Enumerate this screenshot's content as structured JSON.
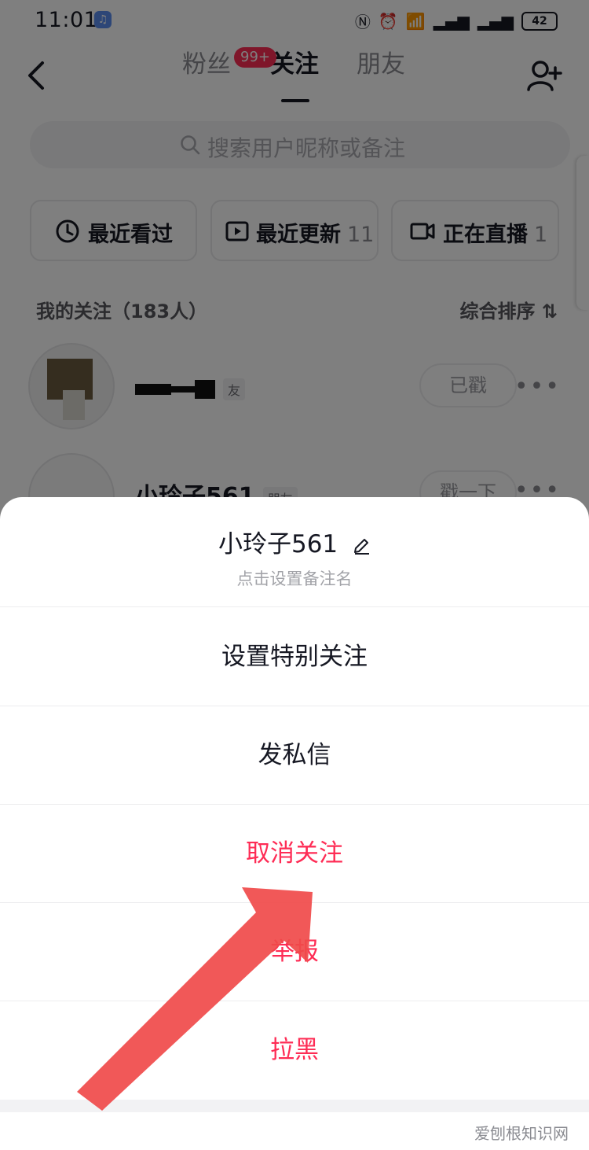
{
  "status_bar": {
    "time": "11:01",
    "battery": "42"
  },
  "header": {
    "tabs": [
      {
        "label": "粉丝"
      },
      {
        "label": "关注"
      },
      {
        "label": "朋友"
      }
    ],
    "fans_badge": "99+"
  },
  "search": {
    "placeholder": "搜索用户昵称或备注"
  },
  "filters": [
    {
      "label": "最近看过",
      "count": ""
    },
    {
      "label": "最近更新",
      "count": "11"
    },
    {
      "label": "正在直播",
      "count": "1"
    }
  ],
  "section": {
    "title": "我的关注（183人）",
    "sort_label": "综合排序"
  },
  "rows": [
    {
      "name": "",
      "tag": "友",
      "action": "已戳"
    },
    {
      "name": "小玲子561",
      "tag": "朋友",
      "action": "戳一下"
    }
  ],
  "sheet": {
    "name": "小玲子561",
    "subtitle": "点击设置备注名",
    "options": [
      {
        "label": "设置特别关注",
        "color": "#161823"
      },
      {
        "label": "发私信",
        "color": "#161823"
      },
      {
        "label": "取消关注",
        "color": "#fe2c55"
      },
      {
        "label": "举报",
        "color": "#fe2c55"
      },
      {
        "label": "拉黑",
        "color": "#fe2c55"
      }
    ]
  },
  "watermark": "爱刨根知识网",
  "colors": {
    "accent": "#fe2c55",
    "arrow": "#f04a4a"
  }
}
